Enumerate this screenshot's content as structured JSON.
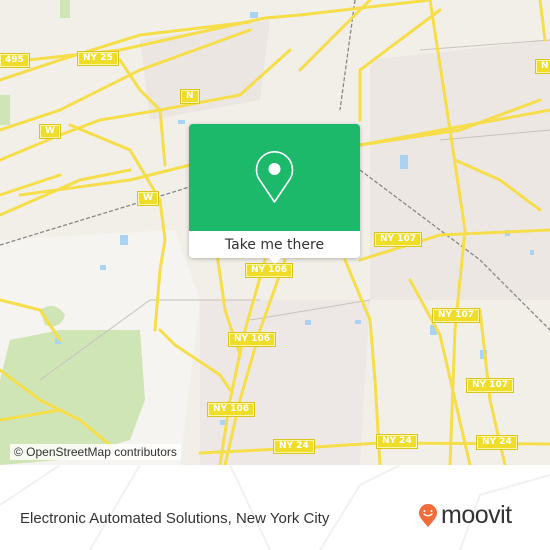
{
  "map": {
    "popup": {
      "icon": "map-pin-icon",
      "button_label": "Take me there",
      "color": "#1db96a"
    },
    "road_labels": [
      {
        "text": "495"
      },
      {
        "text": "NY 25"
      },
      {
        "text": "N"
      },
      {
        "text": "N"
      },
      {
        "text": "W"
      },
      {
        "text": "W"
      },
      {
        "text": "NY 106"
      },
      {
        "text": "NY 106"
      },
      {
        "text": "NY 106"
      },
      {
        "text": "NY 107"
      },
      {
        "text": "NY 107"
      },
      {
        "text": "NY 107"
      },
      {
        "text": "NY 24"
      },
      {
        "text": "NY 24"
      },
      {
        "text": "NY 24"
      }
    ],
    "attribution": "© OpenStreetMap contributors"
  },
  "footer": {
    "title": "Electronic Automated Solutions, New York City",
    "brand": {
      "name": "moovit",
      "icon": "moovit-logo-icon",
      "color": "#f26b3a"
    }
  }
}
